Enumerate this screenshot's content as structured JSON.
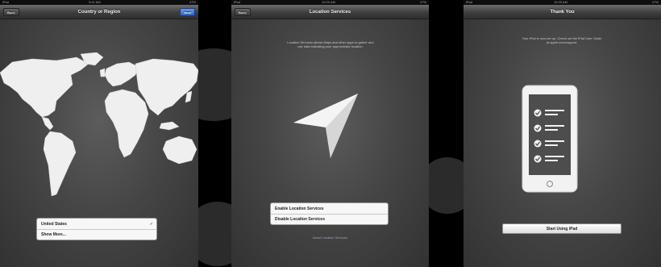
{
  "screens": [
    {
      "status": {
        "carrier": "iPad",
        "time": "9:41 AM",
        "battery": "47%"
      },
      "nav": {
        "title": "Country or Region",
        "left_button": "Back",
        "right_button": "Next"
      },
      "list": [
        {
          "label": "United States",
          "selected": true
        },
        {
          "label": "Show More..."
        }
      ]
    },
    {
      "status": {
        "carrier": "iPad",
        "time": "10:20 AM",
        "battery": "47%"
      },
      "nav": {
        "title": "Location Services",
        "left_button": "Back",
        "right_button": ""
      },
      "info": "Location Services allows Maps and other apps to gather and use data indicating your approximate location.",
      "list": [
        {
          "label": "Enable Location Services"
        },
        {
          "label": "Disable Location Services"
        }
      ],
      "link": "About Location Services"
    },
    {
      "status": {
        "carrier": "iPad",
        "time": "10:20 AM",
        "battery": "47%"
      },
      "nav": {
        "title": "Thank You",
        "left_button": "",
        "right_button": ""
      },
      "info": "Your iPad is now set up. Check out the iPad User Guide at apple.com/support.",
      "button": "Start Using iPad"
    }
  ],
  "icons": {
    "map": "world-map-icon",
    "arrow": "location-arrow-icon",
    "ipad": "ipad-checklist-icon",
    "check": "checkmark-icon"
  }
}
